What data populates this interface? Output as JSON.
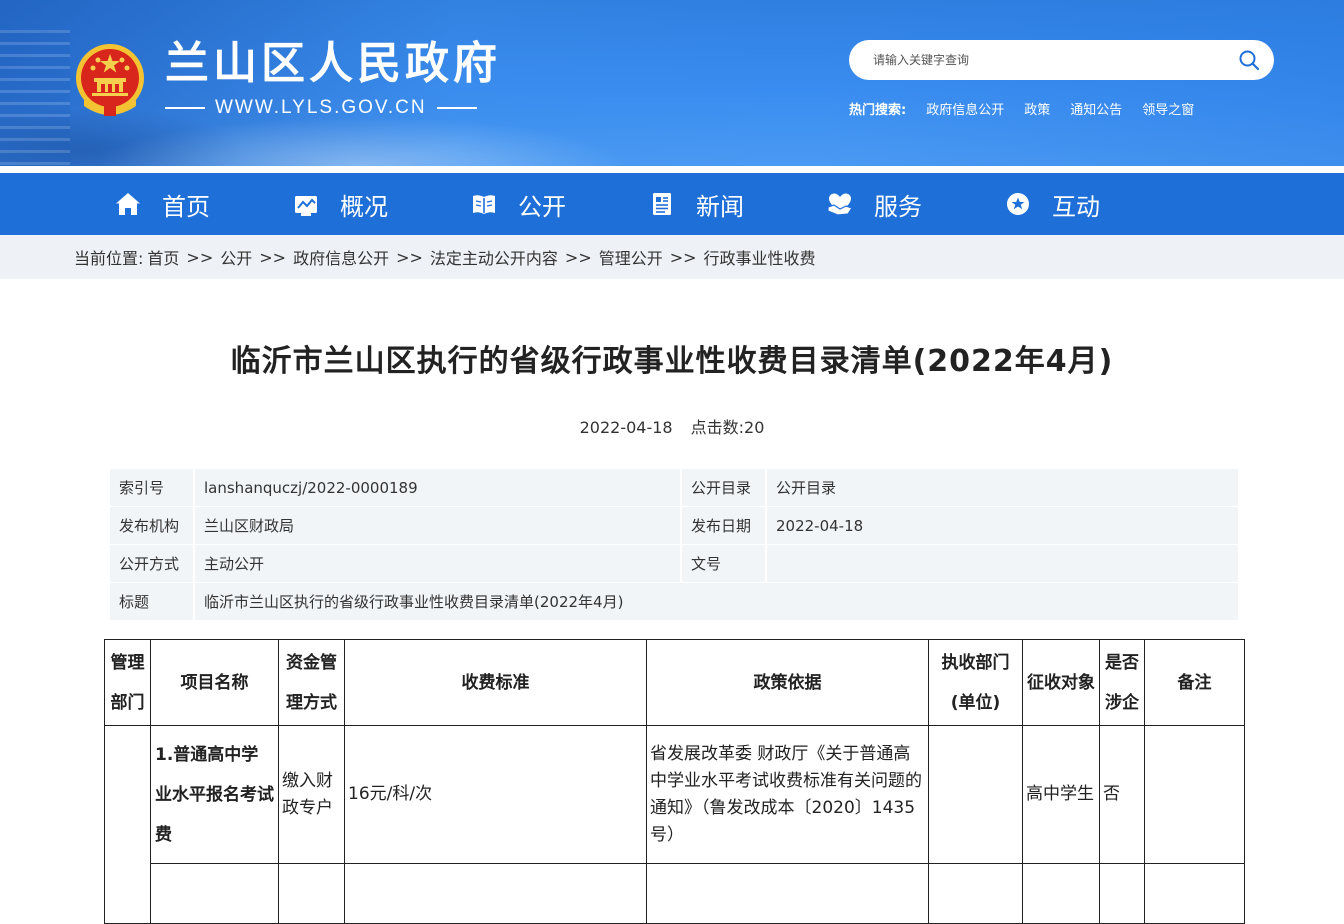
{
  "header": {
    "site_title": "兰山区人民政府",
    "site_url": "WWW.LYLS.GOV.CN",
    "search_placeholder": "请输入关键字查询",
    "hot_label": "热门搜索:",
    "hot_links": [
      "政府信息公开",
      "政策",
      "通知公告",
      "领导之窗"
    ]
  },
  "nav": {
    "items": [
      {
        "label": "首页",
        "icon": "home-icon"
      },
      {
        "label": "概况",
        "icon": "overview-icon"
      },
      {
        "label": "公开",
        "icon": "book-icon"
      },
      {
        "label": "新闻",
        "icon": "news-icon"
      },
      {
        "label": "服务",
        "icon": "heart-hand-icon"
      },
      {
        "label": "互动",
        "icon": "star-bubble-icon"
      }
    ]
  },
  "breadcrumb": {
    "label": "当前位置:",
    "separator": ">>",
    "items": [
      "首页",
      "公开",
      "政府信息公开",
      "法定主动公开内容",
      "管理公开",
      "行政事业性收费"
    ]
  },
  "article": {
    "title": "临沂市兰山区执行的省级行政事业性收费目录清单(2022年4月)",
    "date": "2022-04-18",
    "hits_label": "点击数:",
    "hits": "20"
  },
  "info": {
    "index_label": "索引号",
    "index_value": "lanshanquczj/2022-0000189",
    "catalog_label": "公开目录",
    "catalog_value": "公开目录",
    "org_label": "发布机构",
    "org_value": "兰山区财政局",
    "pubdate_label": "发布日期",
    "pubdate_value": "2022-04-18",
    "method_label": "公开方式",
    "method_value": "主动公开",
    "docno_label": "文号",
    "docno_value": "",
    "title_label": "标题",
    "title_value": "临沂市兰山区执行的省级行政事业性收费目录清单(2022年4月)"
  },
  "fee_table": {
    "headers": [
      "管理部门",
      "项目名称",
      "资金管理方式",
      "收费标准",
      "政策依据",
      "执收部门(单位)",
      "征收对象",
      "是否涉企",
      "备注"
    ],
    "rows": [
      {
        "dept": "",
        "name": "1.普通高中学业水平报名考试费",
        "fund": "缴入财政专户",
        "standard": "16元/科/次",
        "basis": "省发展改革委 财政厅《关于普通高中学业水平考试收费标准有关问题的通知》（鲁发改成本〔2020〕1435号）",
        "unit": "",
        "target": "高中学生",
        "enterprise": "否",
        "remark": ""
      }
    ]
  }
}
